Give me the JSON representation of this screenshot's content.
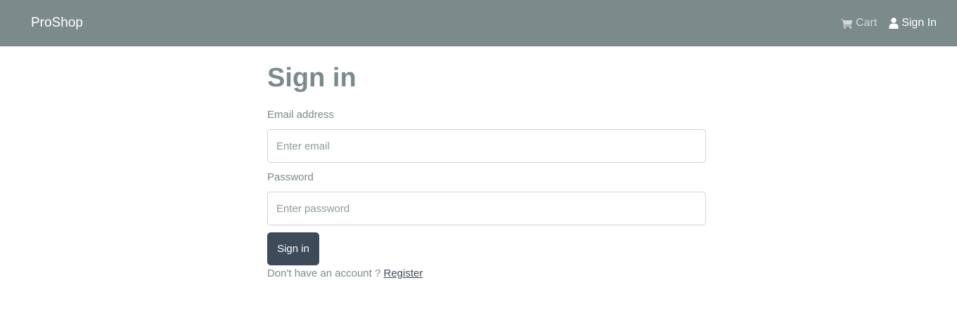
{
  "navbar": {
    "brand": "ProShop",
    "cart_label": "Cart",
    "cart_icon": "shopping-cart-icon",
    "signin_label": "Sign In",
    "signin_icon": "user-icon",
    "background": "#7b8a8b"
  },
  "form": {
    "title": "Sign in",
    "email": {
      "label": "Email address",
      "placeholder": "Enter email",
      "value": ""
    },
    "password": {
      "label": "Password",
      "placeholder": "Enter password",
      "value": ""
    },
    "submit_label": "Sign in",
    "register_prompt": "Don't have an account ?",
    "register_link": "Register",
    "button_color": "#3d4a5a"
  }
}
